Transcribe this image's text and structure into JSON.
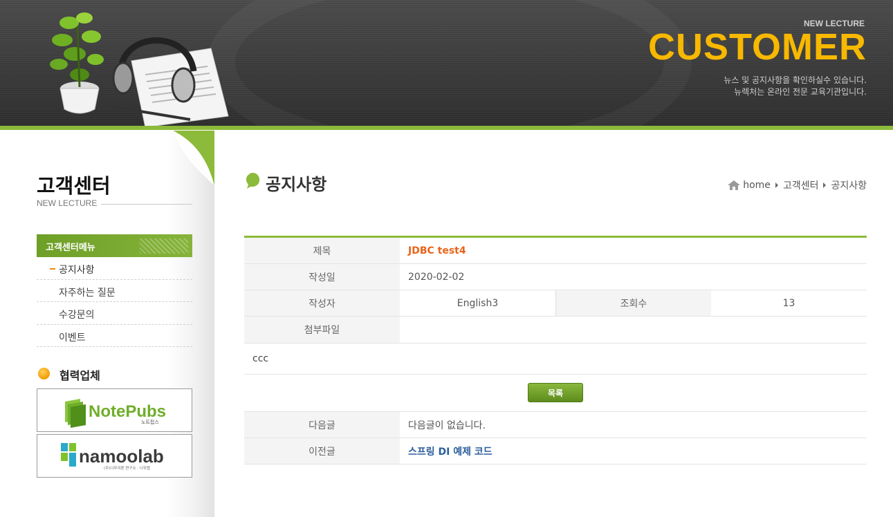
{
  "header": {
    "brand_small": "NEW LECTURE",
    "brand_big": "CUSTOMER",
    "desc_line1": "뉴스 및 공지사항을 확인하실수 있습니다.",
    "desc_line2": "뉴렉처는 온라인 전문 교육기관입니다."
  },
  "sidebar": {
    "title": "고객센터",
    "subtitle": "NEW LECTURE",
    "menu_head": "고객센터메뉴",
    "items": [
      {
        "label": "공지사항"
      },
      {
        "label": "자주하는 질문"
      },
      {
        "label": "수강문의"
      },
      {
        "label": "이벤트"
      }
    ],
    "partner_title": "협력업체",
    "partners": [
      {
        "name": "NotePubs",
        "sub": "노트펍스"
      },
      {
        "name": "namoolab",
        "sub": "(주)나무이론 연구소 · 나무랩"
      }
    ]
  },
  "main": {
    "title": "공지사항",
    "breadcrumb": [
      "home",
      "고객센터",
      "공지사항"
    ]
  },
  "notice": {
    "title_label": "제목",
    "title_value": "JDBC test4",
    "date_label": "작성일",
    "date_value": "2020-02-02",
    "writer_label": "작성자",
    "writer_value": "English3",
    "hit_label": "조회수",
    "hit_value": "13",
    "file_label": "첨부파일",
    "file_value": "",
    "content": "ccc",
    "list_button": "목록",
    "next_label": "다음글",
    "next_value": "다음글이 없습니다.",
    "prev_label": "이전글",
    "prev_value": "스프링 DI 예제 코드"
  },
  "colors": {
    "accent_green": "#8cba3a",
    "brand_yellow": "#f7b800",
    "title_orange": "#e8641a"
  }
}
